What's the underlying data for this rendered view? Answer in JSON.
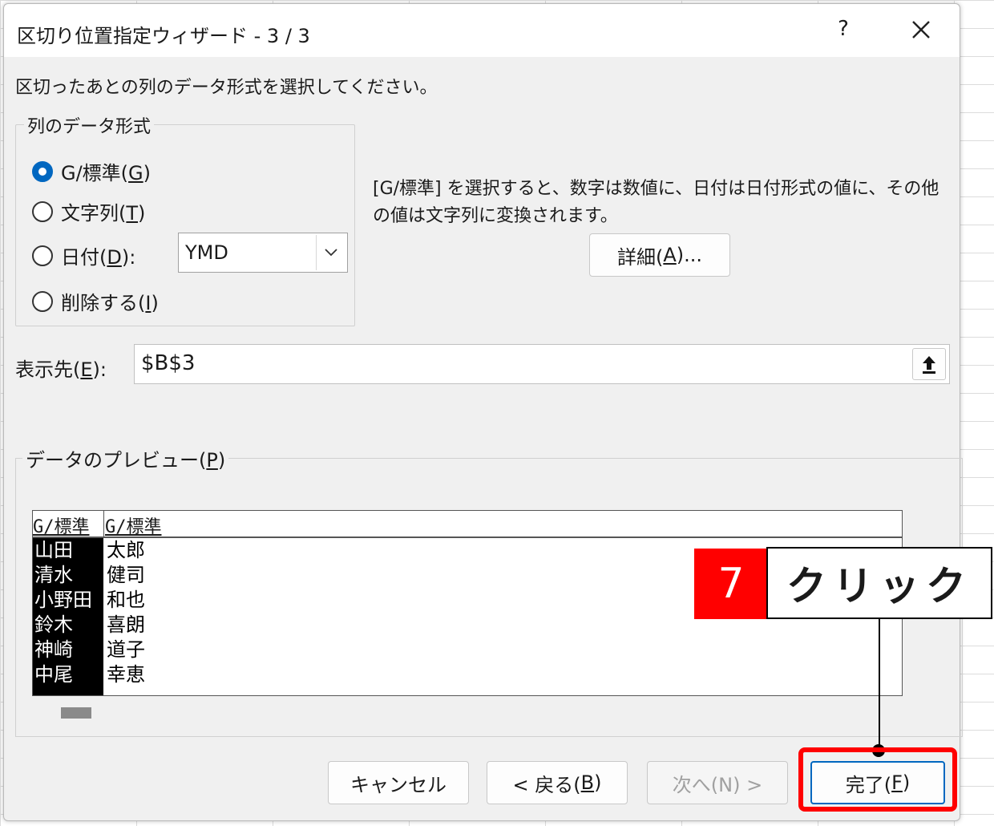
{
  "dialog": {
    "title": "区切り位置指定ウィザード - 3 / 3",
    "help_label": "?",
    "instruction": "区切ったあとの列のデータ形式を選択してください。"
  },
  "column_format": {
    "legend": "列のデータ形式",
    "options": [
      {
        "label_pre": "G/標準(",
        "mnemonic": "G",
        "label_post": ")",
        "selected": true
      },
      {
        "label_pre": "文字列(",
        "mnemonic": "T",
        "label_post": ")",
        "selected": false
      },
      {
        "label_pre": "日付(",
        "mnemonic": "D",
        "label_post": "):",
        "selected": false
      },
      {
        "label_pre": "削除する(",
        "mnemonic": "I",
        "label_post": ")",
        "selected": false
      }
    ],
    "date_format_value": "YMD"
  },
  "description": "[G/標準] を選択すると、数字は数値に、日付は日付形式の値に、その他の値は文字列に変換されます。",
  "advanced_button": {
    "label_pre": "詳細(",
    "mnemonic": "A",
    "label_post": ")..."
  },
  "destination": {
    "label_pre": "表示先(",
    "mnemonic": "E",
    "label_post": "):",
    "value": "$B$3"
  },
  "preview": {
    "legend_pre": "データのプレビュー(",
    "mnemonic": "P",
    "legend_post": ")",
    "headers": [
      "G/標準",
      "G/標準"
    ],
    "rows": [
      [
        "山田",
        "太郎"
      ],
      [
        "清水",
        "健司"
      ],
      [
        "小野田",
        "和也"
      ],
      [
        "鈴木",
        "喜朗"
      ],
      [
        "神崎",
        "道子"
      ],
      [
        "中尾",
        "幸恵"
      ]
    ]
  },
  "buttons": {
    "cancel": "キャンセル",
    "back": {
      "label_pre": "< 戻る(",
      "mnemonic": "B",
      "label_post": ")"
    },
    "next": "次へ(N) >",
    "finish": {
      "label_pre": "完了(",
      "mnemonic": "F",
      "label_post": ")"
    }
  },
  "annotation": {
    "step_number": "7",
    "callout_text": "クリック",
    "highlight_color": "#ff0000"
  },
  "colors": {
    "accent": "#0067c0",
    "dialog_bg": "#f0f0f0"
  }
}
